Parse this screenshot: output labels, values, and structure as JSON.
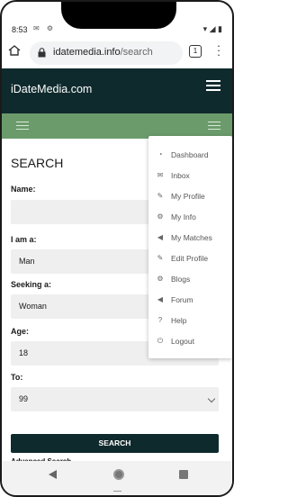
{
  "status_bar": {
    "time": "8:53",
    "left_icons": "✉ ⚙",
    "right_icons": "▾ ◢ ▮"
  },
  "browser": {
    "url_domain": "idatemedia.info",
    "url_path": "/search",
    "tab_count": "1"
  },
  "header": {
    "brand": "iDateMedia.com"
  },
  "search_form": {
    "title": "SEARCH",
    "fields": [
      {
        "label": "Name:",
        "value": ""
      },
      {
        "label": "I am a:",
        "value": "Man"
      },
      {
        "label": "Seeking a:",
        "value": "Woman"
      },
      {
        "label": "Age:",
        "value": "18"
      },
      {
        "label": "To:",
        "value": "99"
      }
    ],
    "submit_label": "SEARCH",
    "partial_below": "Advanced Search"
  },
  "dropdown_menu": {
    "items": [
      {
        "label": "Dashboard",
        "icon": "dashboard-icon",
        "glyph": "◔"
      },
      {
        "label": "Inbox",
        "icon": "inbox-icon",
        "glyph": "✉"
      },
      {
        "label": "My Profile",
        "icon": "edit-icon",
        "glyph": "✎"
      },
      {
        "label": "My Info",
        "icon": "cogs-icon",
        "glyph": "⚙"
      },
      {
        "label": "My Matches",
        "icon": "bullhorn-icon",
        "glyph": "◀"
      },
      {
        "label": "Edit Profile",
        "icon": "edit-icon",
        "glyph": "✎"
      },
      {
        "label": "Blogs",
        "icon": "cogs-icon",
        "glyph": "⚙"
      },
      {
        "label": "Forum",
        "icon": "bullhorn-icon",
        "glyph": "◀"
      },
      {
        "label": "Help",
        "icon": "question-icon",
        "glyph": "?"
      },
      {
        "label": "Logout",
        "icon": "power-icon",
        "glyph": "⏻"
      }
    ]
  },
  "colors": {
    "header_bg": "#0f2a2d",
    "green_bar": "#6b9b6b",
    "field_bg": "#efefef",
    "button_bg": "#0f2a2d"
  }
}
